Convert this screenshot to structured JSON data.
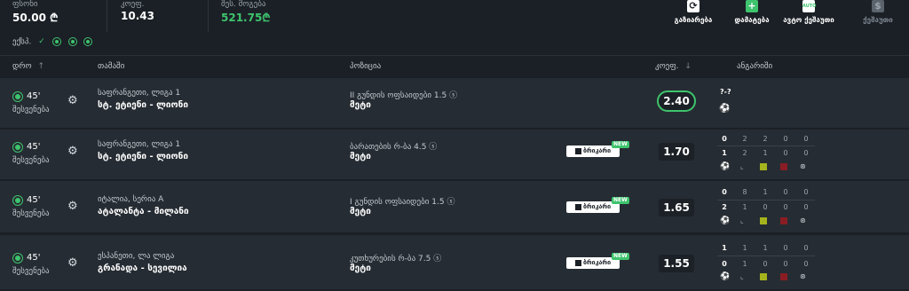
{
  "top": {
    "stats": [
      {
        "label": "ფსონი",
        "value": "50.00 ₾"
      },
      {
        "label": "კოეფ.",
        "value": "10.43"
      },
      {
        "label": "შეს. მოგება",
        "value": "521.75₾"
      }
    ],
    "actions": [
      {
        "label": "გაზიარება",
        "icon": "share-icon",
        "glyph": "⟳"
      },
      {
        "label": "დამატება",
        "icon": "plus-icon",
        "glyph": "+"
      },
      {
        "label": "ავტო ქეშაუთი",
        "icon": "auto-icon",
        "glyph": "AUTO"
      },
      {
        "label": "ქეშაუთი",
        "icon": "dollar-icon",
        "glyph": "$"
      }
    ]
  },
  "filter": {
    "label": "ექსპ."
  },
  "columns": {
    "date": "დრო",
    "date_sort": "↑",
    "event": "თამაში",
    "position": "პოზიცია",
    "odd": "კოეფ.",
    "odd_sort": "↓",
    "stats": "ანგარიში"
  },
  "rows": [
    {
      "minute": "45'",
      "half": "შესვენება",
      "league": "საფრანგეთი, ლიგა 1",
      "teams": "სტ. ეტიენი - ლიონი",
      "market": "II გუნდის ოფსაიდები 1.5 ⓢ",
      "pick": "მეტი",
      "odd": "2.40",
      "unknown": "?-?"
    },
    {
      "minute": "45'",
      "half": "შესვენება",
      "league": "საფრანგეთი, ლიგა 1",
      "teams": "სტ. ეტიენი - ლიონი",
      "market": "ბარათების რ-ბა 4.5 ⓢ",
      "pick": "მეტი",
      "badge": "ბრიკარი",
      "new": "NEW",
      "odd": "1.70",
      "score": [
        [
          "0",
          "2",
          "2",
          "0",
          "0"
        ],
        [
          "1",
          "2",
          "1",
          "0",
          "0"
        ]
      ]
    },
    {
      "minute": "45'",
      "half": "შესვენება",
      "league": "იტალია, სერია A",
      "teams": "ატალანტა - მილანი",
      "market": "I გუნდის ოფსაიდები 1.5 ⓢ",
      "pick": "მეტი",
      "badge": "ბრიკარი",
      "new": "NEW",
      "odd": "1.65",
      "score": [
        [
          "0",
          "8",
          "1",
          "0",
          "0"
        ],
        [
          "2",
          "1",
          "0",
          "0",
          "0"
        ]
      ]
    },
    {
      "minute": "45'",
      "half": "შესვენება",
      "league": "ესპანეთი, ლა ლიგა",
      "teams": "გრანადა - სევილია",
      "market": "კუთხურების რ-ბა 7.5 ⓢ",
      "pick": "მეტი",
      "badge": "ბრიკარი",
      "new": "NEW",
      "odd": "1.55",
      "score": [
        [
          "1",
          "1",
          "1",
          "0",
          "0"
        ],
        [
          "0",
          "1",
          "0",
          "0",
          "0"
        ]
      ]
    }
  ]
}
